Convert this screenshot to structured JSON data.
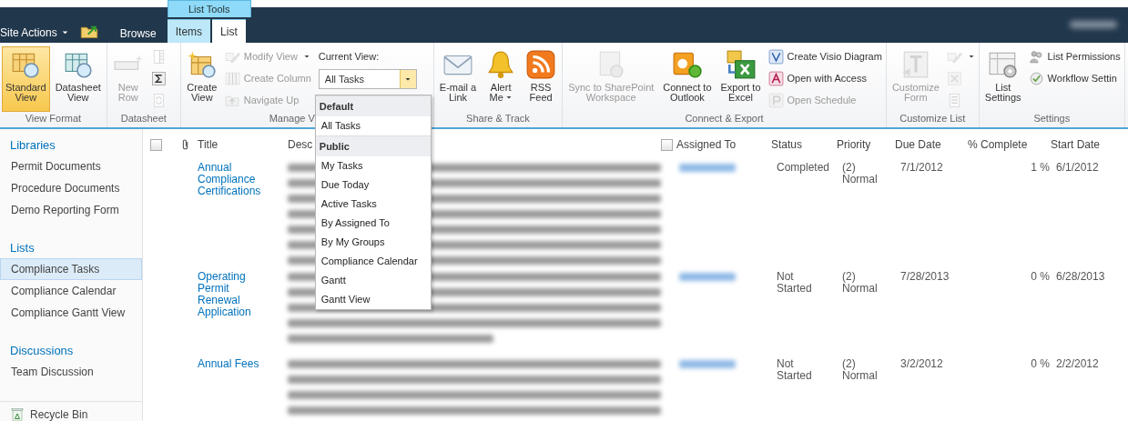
{
  "top_bar": {
    "site_actions": "Site Actions",
    "browse_tab": {
      "label": "Browse",
      "selected": false
    },
    "context_group": "List Tools",
    "context_tabs": [
      {
        "label": "Items",
        "selected": false
      },
      {
        "label": "List",
        "selected": true
      }
    ],
    "user": {
      "kind": "blurred"
    }
  },
  "ribbon": {
    "groups": [
      {
        "label": "View Format",
        "columns": [
          {
            "kind": "large",
            "label": "Standard\nView",
            "selected": true,
            "disabled": false
          },
          {
            "kind": "large",
            "label": "Datasheet\nView",
            "selected": false,
            "disabled": false
          }
        ]
      },
      {
        "label": "Datasheet",
        "columns": [
          {
            "kind": "large",
            "label": "New\nRow",
            "disabled": true
          },
          {
            "kind": "stack",
            "items": [
              {
                "disabled": true
              },
              {
                "disabled": false
              },
              {
                "disabled": true
              }
            ]
          }
        ]
      },
      {
        "label": "Manage V",
        "columns": [
          {
            "kind": "large",
            "label": "Create\nView",
            "disabled": false
          },
          {
            "kind": "stack",
            "items": [
              {
                "label": "Modify View",
                "disabled": true,
                "dropdown": true
              },
              {
                "label": "Create Column",
                "disabled": true
              },
              {
                "label": "Navigate Up",
                "disabled": true
              }
            ]
          },
          {
            "kind": "view-select",
            "label": "Current View:",
            "value": "All Tasks",
            "expanded": true,
            "menu": [
              {
                "kind": "header",
                "label": "Default"
              },
              {
                "kind": "item",
                "label": "All Tasks"
              },
              {
                "kind": "header",
                "label": "Public"
              },
              {
                "kind": "item",
                "label": "My Tasks"
              },
              {
                "kind": "item",
                "label": "Due Today"
              },
              {
                "kind": "item",
                "label": "Active Tasks"
              },
              {
                "kind": "item",
                "label": "By Assigned To"
              },
              {
                "kind": "item",
                "label": "By My Groups"
              },
              {
                "kind": "item",
                "label": "Compliance Calendar"
              },
              {
                "kind": "item",
                "label": "Gantt"
              },
              {
                "kind": "item",
                "label": "Gantt View"
              }
            ]
          }
        ]
      },
      {
        "label": "Share & Track",
        "columns": [
          {
            "kind": "large",
            "label": "E-mail a\nLink",
            "disabled": false
          },
          {
            "kind": "large",
            "label": "Alert\nMe",
            "disabled": false,
            "dropdown": true
          },
          {
            "kind": "large",
            "label": "RSS\nFeed",
            "disabled": false
          }
        ]
      },
      {
        "label": "Connect & Export",
        "columns": [
          {
            "kind": "large",
            "label": "Sync to SharePoint\nWorkspace",
            "disabled": true
          },
          {
            "kind": "large",
            "label": "Connect to\nOutlook",
            "disabled": false
          },
          {
            "kind": "large",
            "label": "Export to\nExcel",
            "disabled": false
          },
          {
            "kind": "stack",
            "items": [
              {
                "label": "Create Visio Diagram",
                "disabled": false
              },
              {
                "label": "Open with Access",
                "disabled": false
              },
              {
                "label": "Open Schedule",
                "disabled": true
              }
            ]
          }
        ]
      },
      {
        "label": "Customize List",
        "columns": [
          {
            "kind": "large",
            "label": "Customize\nForm",
            "disabled": true
          },
          {
            "kind": "stack",
            "items": [
              {
                "disabled": true,
                "dropdown": true
              },
              {
                "disabled": true
              },
              {
                "disabled": true
              }
            ]
          }
        ]
      },
      {
        "label": "Settings",
        "columns": [
          {
            "kind": "large",
            "label": "List\nSettings",
            "disabled": false
          },
          {
            "kind": "stack",
            "items": [
              {
                "label": "List Permissions",
                "disabled": false
              },
              {
                "label": "Workflow Settin",
                "disabled": false
              }
            ]
          }
        ]
      }
    ]
  },
  "sidebar": {
    "sections": [
      {
        "heading": "Libraries",
        "items": [
          {
            "label": "Permit Documents",
            "selected": false
          },
          {
            "label": "Procedure Documents",
            "selected": false
          },
          {
            "label": "Demo Reporting Form",
            "selected": false
          }
        ]
      },
      {
        "heading": "Lists",
        "items": [
          {
            "label": "Compliance Tasks",
            "selected": true
          },
          {
            "label": "Compliance Calendar",
            "selected": false
          },
          {
            "label": "Compliance Gantt View",
            "selected": false
          }
        ]
      },
      {
        "heading": "Discussions",
        "items": [
          {
            "label": "Team Discussion",
            "selected": false
          }
        ]
      }
    ],
    "recycle_bin": "Recycle Bin"
  },
  "table": {
    "columns": [
      {
        "kind": "checkbox",
        "checked": false
      },
      {
        "kind": "attachment"
      },
      {
        "kind": "text",
        "label": "Title"
      },
      {
        "kind": "text",
        "label": "Desc"
      },
      {
        "kind": "checkbox-text",
        "label": "Assigned To",
        "checked": false
      },
      {
        "kind": "text",
        "label": "Status"
      },
      {
        "kind": "text",
        "label": "Priority"
      },
      {
        "kind": "text",
        "label": "Due Date"
      },
      {
        "kind": "text",
        "label": "% Complete"
      },
      {
        "kind": "text",
        "label": "Start Date"
      }
    ],
    "rows": [
      {
        "title": "Annual\nCompliance\nCertifications",
        "description": {
          "kind": "blurred"
        },
        "assigned_to": {
          "kind": "blurred"
        },
        "status": "Completed",
        "priority": "(2)\nNormal",
        "due_date": "7/1/2012",
        "percent_complete": "1 %",
        "start_date": "6/1/2012"
      },
      {
        "title": "Operating\nPermit\nRenewal\nApplication",
        "description": {
          "kind": "blurred"
        },
        "assigned_to": {
          "kind": "blurred"
        },
        "status": "Not\nStarted",
        "priority": "(2)\nNormal",
        "due_date": "7/28/2013",
        "percent_complete": "0 %",
        "start_date": "6/28/2013"
      },
      {
        "title": "Annual Fees",
        "description": {
          "kind": "blurred"
        },
        "assigned_to": {
          "kind": "blurred"
        },
        "status": "Not\nStarted",
        "priority": "(2)\nNormal",
        "due_date": "3/2/2012",
        "percent_complete": "0 %",
        "start_date": "2/2/2012"
      }
    ]
  }
}
